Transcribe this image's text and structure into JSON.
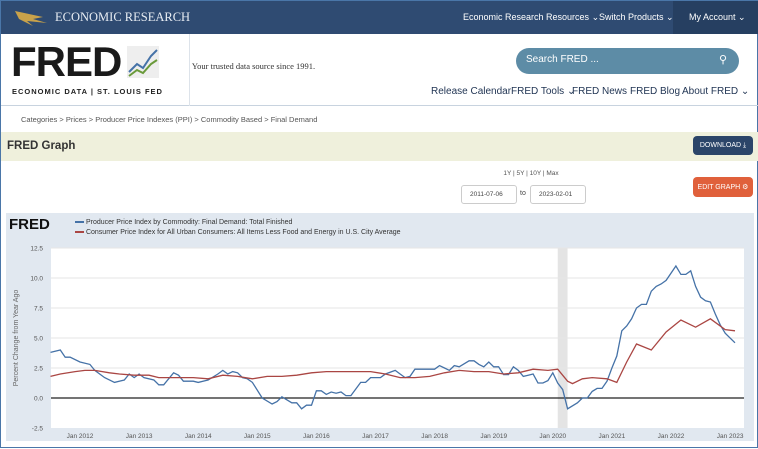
{
  "topbar": {
    "brand": "ECONOMIC RESEARCH",
    "nav": [
      "Economic Research Resources",
      "Switch Products",
      "My Account"
    ]
  },
  "header": {
    "logo": "FRED",
    "logo_sub": "ECONOMIC DATA  |  ST. LOUIS FED",
    "tagline": "Your trusted data source since 1991.",
    "search_placeholder": "Search FRED ...",
    "nav": [
      "Release Calendar",
      "FRED Tools",
      "FRED News",
      "FRED Blog",
      "About FRED"
    ]
  },
  "breadcrumb": "Categories > Prices > Producer Price Indexes (PPI) > Commodity Based > Final Demand",
  "graph": {
    "title": "FRED Graph",
    "download": "DOWNLOAD",
    "edit": "EDIT GRAPH",
    "ranges": "1Y | 5Y | 10Y | Max",
    "start_date": "2011-07-06",
    "to": "to",
    "end_date": "2023-02-01"
  },
  "colors": {
    "ppi": "#4572a7",
    "cpi": "#aa4643",
    "nav": "#2f4b72",
    "edit": "#e0603b"
  },
  "chart_data": {
    "type": "line",
    "ylabel": "Percent Change from Year Ago",
    "ylim": [
      -2.5,
      12.5
    ],
    "yticks": [
      "12.5",
      "10.0",
      "7.5",
      "5.0",
      "2.5",
      "0.0",
      "-2.5"
    ],
    "xticks": [
      "Jan 2012",
      "Jan 2013",
      "Jan 2014",
      "Jan 2015",
      "Jan 2016",
      "Jan 2017",
      "Jan 2018",
      "Jan 2019",
      "Jan 2020",
      "Jan 2021",
      "Jan 2022",
      "Jan 2023"
    ],
    "recession": [
      "2020-02",
      "2020-04"
    ],
    "grid": true,
    "legend": "top-left",
    "series": [
      {
        "name": "Producer Price Index by Commodity: Final Demand: Total Finished",
        "color": "#4572a7",
        "points": [
          [
            "2011-07",
            3.8
          ],
          [
            "2011-09",
            4.0
          ],
          [
            "2011-10",
            3.4
          ],
          [
            "2011-11",
            3.4
          ],
          [
            "2012-01",
            3.0
          ],
          [
            "2012-03",
            2.8
          ],
          [
            "2012-04",
            2.3
          ],
          [
            "2012-06",
            1.7
          ],
          [
            "2012-08",
            1.3
          ],
          [
            "2012-10",
            1.5
          ],
          [
            "2012-11",
            2.0
          ],
          [
            "2012-12",
            1.7
          ],
          [
            "2013-01",
            2.0
          ],
          [
            "2013-02",
            1.7
          ],
          [
            "2013-04",
            1.5
          ],
          [
            "2013-05",
            1.1
          ],
          [
            "2013-06",
            1.1
          ],
          [
            "2013-08",
            2.1
          ],
          [
            "2013-09",
            1.9
          ],
          [
            "2013-10",
            1.4
          ],
          [
            "2013-12",
            1.4
          ],
          [
            "2014-01",
            1.3
          ],
          [
            "2014-03",
            1.5
          ],
          [
            "2014-05",
            2.0
          ],
          [
            "2014-06",
            2.3
          ],
          [
            "2014-07",
            2.0
          ],
          [
            "2014-08",
            2.2
          ],
          [
            "2014-09",
            2.1
          ],
          [
            "2014-10",
            1.7
          ],
          [
            "2014-11",
            1.6
          ],
          [
            "2014-12",
            1.3
          ],
          [
            "2015-02",
            0.0
          ],
          [
            "2015-04",
            -0.5
          ],
          [
            "2015-05",
            -0.3
          ],
          [
            "2015-06",
            0.1
          ],
          [
            "2015-08",
            -0.4
          ],
          [
            "2015-09",
            -0.4
          ],
          [
            "2015-10",
            -0.9
          ],
          [
            "2015-11",
            -0.6
          ],
          [
            "2015-12",
            -0.6
          ],
          [
            "2016-01",
            0.6
          ],
          [
            "2016-02",
            0.6
          ],
          [
            "2016-03",
            0.3
          ],
          [
            "2016-04",
            0.5
          ],
          [
            "2016-05",
            0.4
          ],
          [
            "2016-06",
            0.5
          ],
          [
            "2016-07",
            0.2
          ],
          [
            "2016-08",
            0.2
          ],
          [
            "2016-10",
            1.3
          ],
          [
            "2016-11",
            1.3
          ],
          [
            "2016-12",
            1.7
          ],
          [
            "2017-02",
            1.7
          ],
          [
            "2017-03",
            2.0
          ],
          [
            "2017-05",
            2.3
          ],
          [
            "2017-06",
            2.0
          ],
          [
            "2017-07",
            1.7
          ],
          [
            "2017-08",
            1.8
          ],
          [
            "2017-09",
            2.4
          ],
          [
            "2017-11",
            2.4
          ],
          [
            "2018-01",
            2.4
          ],
          [
            "2018-02",
            2.7
          ],
          [
            "2018-03",
            2.5
          ],
          [
            "2018-04",
            2.3
          ],
          [
            "2018-05",
            2.7
          ],
          [
            "2018-06",
            2.6
          ],
          [
            "2018-08",
            3.1
          ],
          [
            "2018-09",
            3.1
          ],
          [
            "2018-10",
            2.8
          ],
          [
            "2018-11",
            2.6
          ],
          [
            "2018-12",
            3.0
          ],
          [
            "2019-01",
            2.6
          ],
          [
            "2019-02",
            2.6
          ],
          [
            "2019-03",
            1.95
          ],
          [
            "2019-04",
            1.95
          ],
          [
            "2019-05",
            2.6
          ],
          [
            "2019-06",
            2.3
          ],
          [
            "2019-07",
            1.8
          ],
          [
            "2019-08",
            1.9
          ],
          [
            "2019-09",
            2.0
          ],
          [
            "2019-10",
            1.25
          ],
          [
            "2019-11",
            1.25
          ],
          [
            "2019-12",
            1.45
          ],
          [
            "2020-01",
            2.1
          ],
          [
            "2020-02",
            1.25
          ],
          [
            "2020-03",
            0.7
          ],
          [
            "2020-04",
            -0.9
          ],
          [
            "2020-06",
            -0.4
          ],
          [
            "2020-07",
            0.0
          ],
          [
            "2020-08",
            0.0
          ],
          [
            "2020-09",
            0.55
          ],
          [
            "2020-10",
            0.8
          ],
          [
            "2020-11",
            0.8
          ],
          [
            "2020-12",
            1.4
          ],
          [
            "2021-01",
            2.5
          ],
          [
            "2021-02",
            3.5
          ],
          [
            "2021-03",
            5.6
          ],
          [
            "2021-04",
            6.0
          ],
          [
            "2021-05",
            6.6
          ],
          [
            "2021-06",
            7.5
          ],
          [
            "2021-07",
            7.8
          ],
          [
            "2021-08",
            7.8
          ],
          [
            "2021-09",
            8.9
          ],
          [
            "2021-10",
            9.3
          ],
          [
            "2021-11",
            9.5
          ],
          [
            "2021-12",
            9.8
          ],
          [
            "2022-02",
            11.0
          ],
          [
            "2022-03",
            10.3
          ],
          [
            "2022-04",
            10.3
          ],
          [
            "2022-05",
            10.6
          ],
          [
            "2022-06",
            9.3
          ],
          [
            "2022-07",
            8.4
          ],
          [
            "2022-08",
            8.1
          ],
          [
            "2022-09",
            8.0
          ],
          [
            "2022-10",
            7.0
          ],
          [
            "2022-11",
            6.1
          ],
          [
            "2022-12",
            5.4
          ],
          [
            "2023-02",
            4.6
          ]
        ]
      },
      {
        "name": "Consumer Price Index for All Urban Consumers: All Items Less Food and Energy in U.S. City Average",
        "color": "#aa4643",
        "points": [
          [
            "2011-07",
            1.8
          ],
          [
            "2011-09",
            2.0
          ],
          [
            "2011-12",
            2.2
          ],
          [
            "2012-02",
            2.3
          ],
          [
            "2012-04",
            2.3
          ],
          [
            "2012-07",
            2.1
          ],
          [
            "2012-09",
            2.0
          ],
          [
            "2012-12",
            1.9
          ],
          [
            "2013-03",
            1.9
          ],
          [
            "2013-05",
            1.7
          ],
          [
            "2013-09",
            1.7
          ],
          [
            "2013-12",
            1.7
          ],
          [
            "2014-03",
            1.6
          ],
          [
            "2014-06",
            1.9
          ],
          [
            "2014-09",
            1.8
          ],
          [
            "2014-12",
            1.6
          ],
          [
            "2015-03",
            1.8
          ],
          [
            "2015-06",
            1.8
          ],
          [
            "2015-09",
            1.9
          ],
          [
            "2015-12",
            2.1
          ],
          [
            "2016-03",
            2.2
          ],
          [
            "2016-06",
            2.2
          ],
          [
            "2016-09",
            2.2
          ],
          [
            "2016-12",
            2.2
          ],
          [
            "2017-03",
            2.0
          ],
          [
            "2017-06",
            1.7
          ],
          [
            "2017-09",
            1.7
          ],
          [
            "2017-12",
            1.8
          ],
          [
            "2018-03",
            2.1
          ],
          [
            "2018-06",
            2.3
          ],
          [
            "2018-09",
            2.2
          ],
          [
            "2018-12",
            2.2
          ],
          [
            "2019-03",
            2.0
          ],
          [
            "2019-06",
            2.1
          ],
          [
            "2019-09",
            2.4
          ],
          [
            "2019-12",
            2.3
          ],
          [
            "2020-02",
            2.4
          ],
          [
            "2020-04",
            1.4
          ],
          [
            "2020-05",
            1.2
          ],
          [
            "2020-07",
            1.6
          ],
          [
            "2020-09",
            1.7
          ],
          [
            "2020-12",
            1.6
          ],
          [
            "2021-02",
            1.3
          ],
          [
            "2021-04",
            3.0
          ],
          [
            "2021-06",
            4.5
          ],
          [
            "2021-09",
            4.0
          ],
          [
            "2021-12",
            5.5
          ],
          [
            "2022-03",
            6.5
          ],
          [
            "2022-06",
            5.9
          ],
          [
            "2022-09",
            6.6
          ],
          [
            "2022-12",
            5.7
          ],
          [
            "2023-02",
            5.6
          ]
        ]
      }
    ]
  }
}
